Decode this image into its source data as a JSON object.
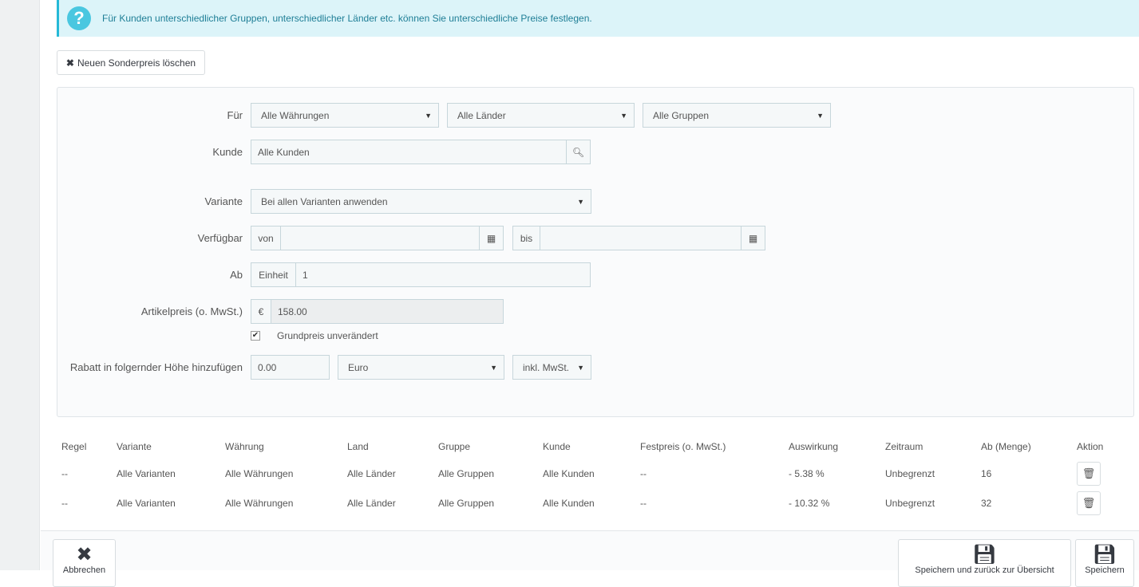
{
  "alert": {
    "text": "Für Kunden unterschiedlicher Gruppen, unterschiedlicher Länder etc. können Sie unterschiedliche Preise festlegen.",
    "icon": "question-icon"
  },
  "delete_button": "Neuen Sonderpreis löschen",
  "form": {
    "fuer_label": "Für",
    "currency": "Alle Währungen",
    "country": "Alle Länder",
    "group": "Alle Gruppen",
    "kunde_label": "Kunde",
    "kunde_value": "Alle Kunden",
    "variante_label": "Variante",
    "variante_value": "Bei allen Varianten anwenden",
    "verfuegbar_label": "Verfügbar",
    "von": "von",
    "bis": "bis",
    "ab_label": "Ab",
    "einheit": "Einheit",
    "ab_value": "1",
    "preis_label": "Artikelpreis (o. MwSt.)",
    "currency_symbol": "€",
    "preis_value": "158.00",
    "grundpreis_label": "Grundpreis unverändert",
    "grundpreis_checked": true,
    "rabatt_label": "Rabatt in folgernder Höhe hinzufügen",
    "rabatt_value": "0.00",
    "rabatt_type": "Euro",
    "rabatt_tax": "inkl. MwSt."
  },
  "table": {
    "headers": [
      "Regel",
      "Variante",
      "Währung",
      "Land",
      "Gruppe",
      "Kunde",
      "Festpreis (o. MwSt.)",
      "Auswirkung",
      "Zeitraum",
      "Ab (Menge)",
      "Aktion"
    ],
    "rows": [
      [
        "--",
        "Alle Varianten",
        "Alle Währungen",
        "Alle Länder",
        "Alle Gruppen",
        "Alle Kunden",
        "--",
        "- 5.38 %",
        "Unbegrenzt",
        "16"
      ],
      [
        "--",
        "Alle Varianten",
        "Alle Währungen",
        "Alle Länder",
        "Alle Gruppen",
        "Alle Kunden",
        "--",
        "- 10.32 %",
        "Unbegrenzt",
        "32"
      ]
    ]
  },
  "footer": {
    "cancel": "Abbrechen",
    "save_back": "Speichern und zurück zur Übersicht",
    "save": "Speichern"
  }
}
